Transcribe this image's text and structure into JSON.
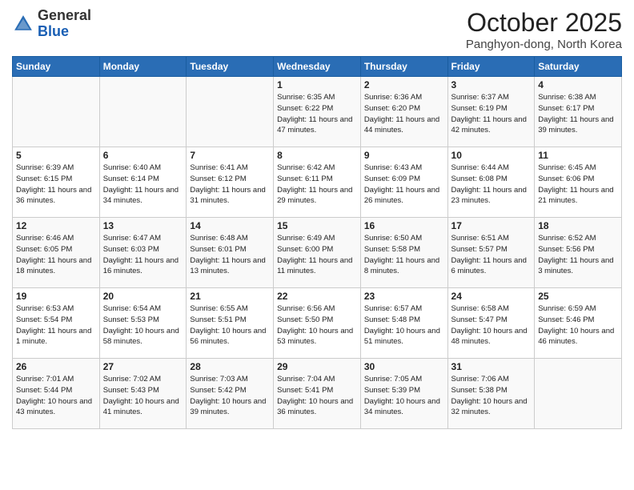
{
  "header": {
    "logo_general": "General",
    "logo_blue": "Blue",
    "month_title": "October 2025",
    "subtitle": "Panghyon-dong, North Korea"
  },
  "days_of_week": [
    "Sunday",
    "Monday",
    "Tuesday",
    "Wednesday",
    "Thursday",
    "Friday",
    "Saturday"
  ],
  "weeks": [
    [
      {
        "day": "",
        "info": ""
      },
      {
        "day": "",
        "info": ""
      },
      {
        "day": "",
        "info": ""
      },
      {
        "day": "1",
        "info": "Sunrise: 6:35 AM\nSunset: 6:22 PM\nDaylight: 11 hours and 47 minutes."
      },
      {
        "day": "2",
        "info": "Sunrise: 6:36 AM\nSunset: 6:20 PM\nDaylight: 11 hours and 44 minutes."
      },
      {
        "day": "3",
        "info": "Sunrise: 6:37 AM\nSunset: 6:19 PM\nDaylight: 11 hours and 42 minutes."
      },
      {
        "day": "4",
        "info": "Sunrise: 6:38 AM\nSunset: 6:17 PM\nDaylight: 11 hours and 39 minutes."
      }
    ],
    [
      {
        "day": "5",
        "info": "Sunrise: 6:39 AM\nSunset: 6:15 PM\nDaylight: 11 hours and 36 minutes."
      },
      {
        "day": "6",
        "info": "Sunrise: 6:40 AM\nSunset: 6:14 PM\nDaylight: 11 hours and 34 minutes."
      },
      {
        "day": "7",
        "info": "Sunrise: 6:41 AM\nSunset: 6:12 PM\nDaylight: 11 hours and 31 minutes."
      },
      {
        "day": "8",
        "info": "Sunrise: 6:42 AM\nSunset: 6:11 PM\nDaylight: 11 hours and 29 minutes."
      },
      {
        "day": "9",
        "info": "Sunrise: 6:43 AM\nSunset: 6:09 PM\nDaylight: 11 hours and 26 minutes."
      },
      {
        "day": "10",
        "info": "Sunrise: 6:44 AM\nSunset: 6:08 PM\nDaylight: 11 hours and 23 minutes."
      },
      {
        "day": "11",
        "info": "Sunrise: 6:45 AM\nSunset: 6:06 PM\nDaylight: 11 hours and 21 minutes."
      }
    ],
    [
      {
        "day": "12",
        "info": "Sunrise: 6:46 AM\nSunset: 6:05 PM\nDaylight: 11 hours and 18 minutes."
      },
      {
        "day": "13",
        "info": "Sunrise: 6:47 AM\nSunset: 6:03 PM\nDaylight: 11 hours and 16 minutes."
      },
      {
        "day": "14",
        "info": "Sunrise: 6:48 AM\nSunset: 6:01 PM\nDaylight: 11 hours and 13 minutes."
      },
      {
        "day": "15",
        "info": "Sunrise: 6:49 AM\nSunset: 6:00 PM\nDaylight: 11 hours and 11 minutes."
      },
      {
        "day": "16",
        "info": "Sunrise: 6:50 AM\nSunset: 5:58 PM\nDaylight: 11 hours and 8 minutes."
      },
      {
        "day": "17",
        "info": "Sunrise: 6:51 AM\nSunset: 5:57 PM\nDaylight: 11 hours and 6 minutes."
      },
      {
        "day": "18",
        "info": "Sunrise: 6:52 AM\nSunset: 5:56 PM\nDaylight: 11 hours and 3 minutes."
      }
    ],
    [
      {
        "day": "19",
        "info": "Sunrise: 6:53 AM\nSunset: 5:54 PM\nDaylight: 11 hours and 1 minute."
      },
      {
        "day": "20",
        "info": "Sunrise: 6:54 AM\nSunset: 5:53 PM\nDaylight: 10 hours and 58 minutes."
      },
      {
        "day": "21",
        "info": "Sunrise: 6:55 AM\nSunset: 5:51 PM\nDaylight: 10 hours and 56 minutes."
      },
      {
        "day": "22",
        "info": "Sunrise: 6:56 AM\nSunset: 5:50 PM\nDaylight: 10 hours and 53 minutes."
      },
      {
        "day": "23",
        "info": "Sunrise: 6:57 AM\nSunset: 5:48 PM\nDaylight: 10 hours and 51 minutes."
      },
      {
        "day": "24",
        "info": "Sunrise: 6:58 AM\nSunset: 5:47 PM\nDaylight: 10 hours and 48 minutes."
      },
      {
        "day": "25",
        "info": "Sunrise: 6:59 AM\nSunset: 5:46 PM\nDaylight: 10 hours and 46 minutes."
      }
    ],
    [
      {
        "day": "26",
        "info": "Sunrise: 7:01 AM\nSunset: 5:44 PM\nDaylight: 10 hours and 43 minutes."
      },
      {
        "day": "27",
        "info": "Sunrise: 7:02 AM\nSunset: 5:43 PM\nDaylight: 10 hours and 41 minutes."
      },
      {
        "day": "28",
        "info": "Sunrise: 7:03 AM\nSunset: 5:42 PM\nDaylight: 10 hours and 39 minutes."
      },
      {
        "day": "29",
        "info": "Sunrise: 7:04 AM\nSunset: 5:41 PM\nDaylight: 10 hours and 36 minutes."
      },
      {
        "day": "30",
        "info": "Sunrise: 7:05 AM\nSunset: 5:39 PM\nDaylight: 10 hours and 34 minutes."
      },
      {
        "day": "31",
        "info": "Sunrise: 7:06 AM\nSunset: 5:38 PM\nDaylight: 10 hours and 32 minutes."
      },
      {
        "day": "",
        "info": ""
      }
    ]
  ]
}
